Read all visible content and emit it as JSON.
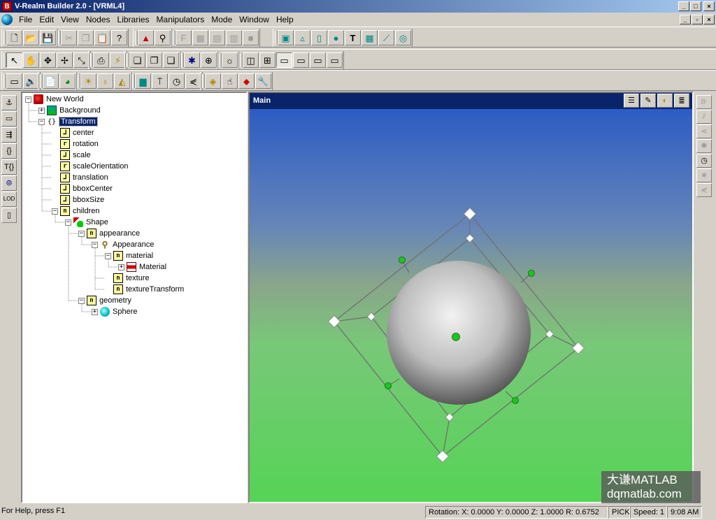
{
  "window": {
    "title": "V-Realm Builder 2.0 - [VRML4]",
    "app_icon_letter": "B",
    "controls": [
      "_",
      "□",
      "×"
    ]
  },
  "menu": [
    "File",
    "Edit",
    "View",
    "Nodes",
    "Libraries",
    "Manipulators",
    "Mode",
    "Window",
    "Help"
  ],
  "mdi_controls": [
    "_",
    "▫",
    "×"
  ],
  "toolbars": {
    "row1": [
      "new-icon",
      "open-icon",
      "save-icon",
      "cut-icon",
      "copy-icon",
      "paste-icon",
      "help-icon",
      "shape-icon",
      "appearance-icon",
      "fontstyle-icon",
      "image-texture-icon",
      "movie-texture-icon",
      "pixel-texture-icon",
      "texture-transform-icon",
      "box-icon",
      "cone-icon",
      "cylinder-icon",
      "sphere-icon",
      "text-icon",
      "elevation-grid-icon",
      "extrusion-icon",
      "indexed-face-set-icon"
    ],
    "row2": [
      "select-icon",
      "hand-icon",
      "move-icon",
      "rotate-icon",
      "scale-icon",
      "print-icon",
      "lightning-icon",
      "view1-icon",
      "view2-icon",
      "view3-icon",
      "snowflake-icon",
      "globe-icon",
      "light-bulb-icon",
      "single-view-icon",
      "quad-view-icon",
      "split-view-1-icon",
      "split-view-2-icon",
      "split-view-3-icon",
      "split-view-4-icon"
    ],
    "row3": [
      "panel-icon",
      "sound-icon",
      "script-icon",
      "earth-icon",
      "directional-light-icon",
      "point-light-icon",
      "spot-light-icon",
      "background-icon",
      "viewpoint-icon",
      "time-sensor-icon",
      "interpolator-icon",
      "proximity-icon",
      "touch-icon",
      "plane-sensor-icon",
      "wrench-icon"
    ]
  },
  "left_toolbar": [
    "anchor-icon",
    "billboard-icon",
    "collision-icon",
    "group-icon",
    "transform-icon",
    "switch-icon",
    "lod-icon",
    "inline-icon"
  ],
  "right_toolbar": [
    "orient-1-icon",
    "orient-2-icon",
    "orient-3-icon",
    "orient-4-icon",
    "orient-5-icon",
    "orient-6-icon",
    "orient-7-icon"
  ],
  "tree": {
    "nodes": [
      {
        "label": "New World",
        "icon": "world",
        "level": 0,
        "expander": "minus"
      },
      {
        "label": "Background",
        "icon": "bg",
        "level": 1,
        "expander": "plus"
      },
      {
        "label": "Transform",
        "icon": "xform",
        "level": 1,
        "expander": "minus",
        "selected": true
      },
      {
        "label": "center",
        "icon": "field",
        "glyph": "⅃",
        "level": 2,
        "expander": "none"
      },
      {
        "label": "rotation",
        "icon": "field",
        "glyph": "r",
        "level": 2,
        "expander": "none"
      },
      {
        "label": "scale",
        "icon": "field",
        "glyph": "⅃",
        "level": 2,
        "expander": "none"
      },
      {
        "label": "scaleOrientation",
        "icon": "field",
        "glyph": "r",
        "level": 2,
        "expander": "none"
      },
      {
        "label": "translation",
        "icon": "field",
        "glyph": "⅃",
        "level": 2,
        "expander": "none"
      },
      {
        "label": "bboxCenter",
        "icon": "field",
        "glyph": "⅃",
        "level": 2,
        "expander": "none"
      },
      {
        "label": "bboxSize",
        "icon": "field",
        "glyph": "⅃",
        "level": 2,
        "expander": "none"
      },
      {
        "label": "children",
        "icon": "field",
        "glyph": "n",
        "level": 2,
        "expander": "minus"
      },
      {
        "label": "Shape",
        "icon": "shape",
        "level": 3,
        "expander": "minus"
      },
      {
        "label": "appearance",
        "icon": "field",
        "glyph": "n",
        "level": 4,
        "expander": "minus"
      },
      {
        "label": "Appearance",
        "icon": "appear",
        "glyph": "⚲",
        "level": 5,
        "expander": "minus"
      },
      {
        "label": "material",
        "icon": "field",
        "glyph": "n",
        "level": 6,
        "expander": "minus"
      },
      {
        "label": "Material",
        "icon": "mat",
        "level": 7,
        "expander": "plus"
      },
      {
        "label": "texture",
        "icon": "field",
        "glyph": "n",
        "level": 6,
        "expander": "none"
      },
      {
        "label": "textureTransform",
        "icon": "field",
        "glyph": "n",
        "level": 6,
        "expander": "none"
      },
      {
        "label": "geometry",
        "icon": "field",
        "glyph": "n",
        "level": 4,
        "expander": "minus"
      },
      {
        "label": "Sphere",
        "icon": "sphere",
        "level": 5,
        "expander": "plus"
      }
    ]
  },
  "viewport": {
    "title": "Main",
    "tools": [
      "navigate-icon",
      "edit-pencil-icon",
      "headlight-icon",
      "view-options-icon"
    ]
  },
  "watermark": {
    "line1": "大谦MATLAB",
    "line2": "dqmatlab.com"
  },
  "status": {
    "help": "For Help, press F1",
    "rotation": "Rotation: X: 0.0000  Y: 0.0000  Z: 1.0000  R: 0.6752",
    "mode": "PICK",
    "speed": "Speed: 1",
    "time": "9:08 AM"
  }
}
